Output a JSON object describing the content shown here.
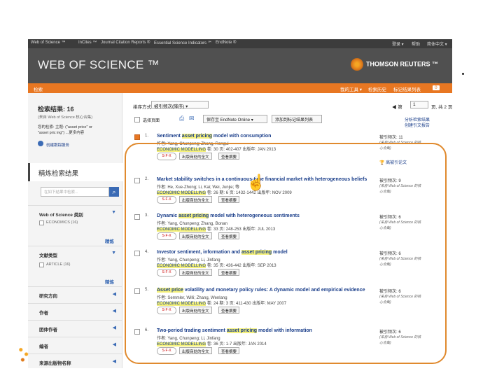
{
  "topnav": {
    "links": [
      "Web of Science ™",
      "InCites ™",
      "Journal Citation Reports ®",
      "Essential Science Indicators ℠",
      "EndNote ®"
    ],
    "right": [
      "登录 ▾",
      "帮助",
      "简体中文 ▾"
    ]
  },
  "header": {
    "logo": "WEB OF SCIENCE ™",
    "brand": "THOMSON REUTERS ™"
  },
  "orangebar": {
    "search": "检索",
    "tools": "我的工具 ▾",
    "history": "检索历史",
    "marked": "标记结果列表",
    "marked_count": "0"
  },
  "sidebar": {
    "result_label": "检索结果: 16",
    "result_sub": "(来自 Web of Science 核心合集)",
    "query_label": "您的检索: 主题: (\"asset price\" or",
    "query_line2": "\"asset pric ing\") ...更多内容",
    "alert": "创建跟踪服务",
    "refine_title": "精炼检索结果",
    "search_placeholder": "在如下结果中检索...",
    "categories_title": "Web of Science 类别",
    "cat_item": "ECONOMICS (16)",
    "refine_btn": "精炼",
    "doctype_title": "文献类型",
    "doc_item": "ARTICLE (16)",
    "refine_btn2": "精炼",
    "sections": [
      "研究方向",
      "作者",
      "团体作者",
      "编者",
      "来源出版物名称"
    ]
  },
  "main": {
    "sort_label": "排序方式:",
    "sort_value": "被引频次(降序) ▾",
    "page": "◀  第",
    "page_num": "1",
    "page_total": "页, 共 2 页  ▶",
    "select_page": "选择页面",
    "save_endnote": "保存至 EndNote Online ▾",
    "add_marked": "添加到标记结果列表",
    "analyze": "分析检索结果",
    "citation_report": "创建引文报告",
    "records": [
      {
        "num": "1.",
        "title_a": "Sentiment ",
        "title_hl": "asset pricing",
        "title_b": " model with consumption",
        "authors": "作者: Yang, Chunpeng; Zhang, Rengui",
        "journal": "ECONOMIC MODELLING",
        "src_rest": "  卷: 30  页: 402-407  出版年: JAN 2013",
        "cites": "被引频次: 11",
        "checked": true,
        "highly_cited": "高被引论文"
      },
      {
        "num": "2.",
        "title_a": "Market stability switches in a continuous-time financial market with heterogeneous beliefs",
        "title_hl": "",
        "title_b": "",
        "authors": "作者: He, Xue-Zhong; Li, Kai; Wei, Junjie; 等",
        "journal": "ECONOMIC MODELLING",
        "src_rest": "  卷: 26  期: 6  页: 1432-1442  出版年: NOV 2009",
        "cites": "被引频次: 9",
        "checked": false,
        "highly_cited": ""
      },
      {
        "num": "3.",
        "title_a": "Dynamic ",
        "title_hl": "asset pricing",
        "title_b": " model with heterogeneous sentiments",
        "authors": "作者: Yang, Chunpeng; Zhang, Bonan",
        "journal": "ECONOMIC MODELLING",
        "src_rest": "  卷: 33  页: 248-253  出版年: JUL 2013",
        "cites": "被引频次: 6",
        "checked": false,
        "highly_cited": ""
      },
      {
        "num": "4.",
        "title_a": "Investor sentiment, information and ",
        "title_hl": "asset pricing",
        "title_b": " model",
        "authors": "作者: Yang, Chunpeng; Li, Jinfang",
        "journal": "ECONOMIC MODELLING",
        "src_rest": "  卷: 35  页: 436-442  出版年: SEP 2013",
        "cites": "被引频次: 6",
        "checked": false,
        "highly_cited": ""
      },
      {
        "num": "5.",
        "title_a": "",
        "title_hl": "Asset price",
        "title_b": " volatility and monetary policy rules: A dynamic model and empirical evidence",
        "authors": "作者: Semmler, Willi; Zhang, Wenlang",
        "journal": "ECONOMIC MODELLING",
        "src_rest": "  卷: 24  期: 3  页: 411-430  出版年: MAY 2007",
        "cites": "被引频次: 6",
        "checked": false,
        "highly_cited": ""
      },
      {
        "num": "6.",
        "title_a": "Two-period trading sentiment ",
        "title_hl": "asset pricing",
        "title_b": " model with information",
        "authors": "作者: Yang, Chunpeng; Li, Jinfang",
        "journal": "ECONOMIC MODELLING",
        "src_rest": "  卷: 36  页: 1-7  出版年: JAN 2014",
        "cites": "被引频次: 6",
        "checked": false,
        "highly_cited": ""
      }
    ],
    "cites_sub": "(来自 Web of Science 的核",
    "cites_sub2": "心合集)",
    "fulltext_btn": "出版商处的全文",
    "abstract_btn": "查看摘要",
    "sfx": "S·F·X"
  }
}
